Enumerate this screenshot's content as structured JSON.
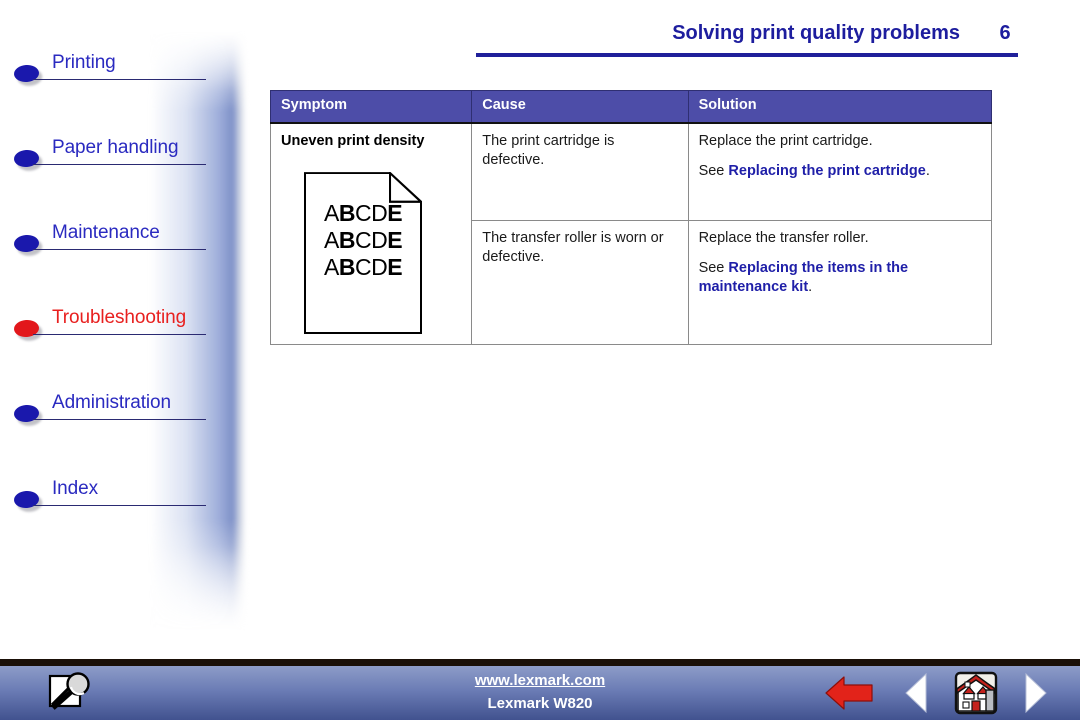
{
  "sidebar": {
    "items": [
      {
        "label": "Printing",
        "active": false,
        "icon": "bullet-icon"
      },
      {
        "label": "Paper handling",
        "active": false,
        "icon": "bullet-icon"
      },
      {
        "label": "Maintenance",
        "active": false,
        "icon": "bullet-icon"
      },
      {
        "label": "Troubleshooting",
        "active": true,
        "icon": "bullet-icon"
      },
      {
        "label": "Administration",
        "active": false,
        "icon": "bullet-icon"
      },
      {
        "label": "Index",
        "active": false,
        "icon": "bullet-icon"
      }
    ],
    "colors": {
      "inactive": "#2a2ac0",
      "active": "#e8201f",
      "rule": "#2a2a72"
    }
  },
  "header": {
    "title": "Solving print quality problems",
    "page_number": "6",
    "accent_color": "#20209a"
  },
  "table": {
    "columns": [
      "Symptom",
      "Cause",
      "Solution"
    ],
    "header_bg": "#4d4da8",
    "rows": [
      {
        "symptom": "Uneven print density",
        "symptom_illustration": {
          "type": "printed-page-sample",
          "lines": [
            "ABCDE",
            "ABCDE",
            "ABCDE"
          ],
          "bold_letters": [
            "B",
            "E"
          ]
        },
        "cause": "The print cartridge is defective.",
        "solution_line1": "Replace the print cartridge.",
        "solution_see_prefix": "See ",
        "solution_link": "Replacing the print cartridge",
        "solution_suffix": "."
      },
      {
        "symptom": "",
        "cause": "The transfer roller is worn or defective.",
        "solution_line1": "Replace the transfer roller.",
        "solution_see_prefix": "See ",
        "solution_link": "Replacing the items in the maintenance kit",
        "solution_suffix": "."
      }
    ]
  },
  "footer": {
    "url": "www.lexmark.com",
    "product": "Lexmark W820",
    "icons": [
      {
        "name": "search-icon",
        "title": "Search"
      },
      {
        "name": "back-arrow-icon",
        "title": "Go back"
      },
      {
        "name": "previous-page-icon",
        "title": "Previous page"
      },
      {
        "name": "home-icon",
        "title": "Home"
      },
      {
        "name": "next-page-icon",
        "title": "Next page"
      }
    ],
    "colors": {
      "band_top": "#8d9cc8",
      "band_bottom": "#41528f",
      "back_arrow": "#e2231a"
    }
  }
}
